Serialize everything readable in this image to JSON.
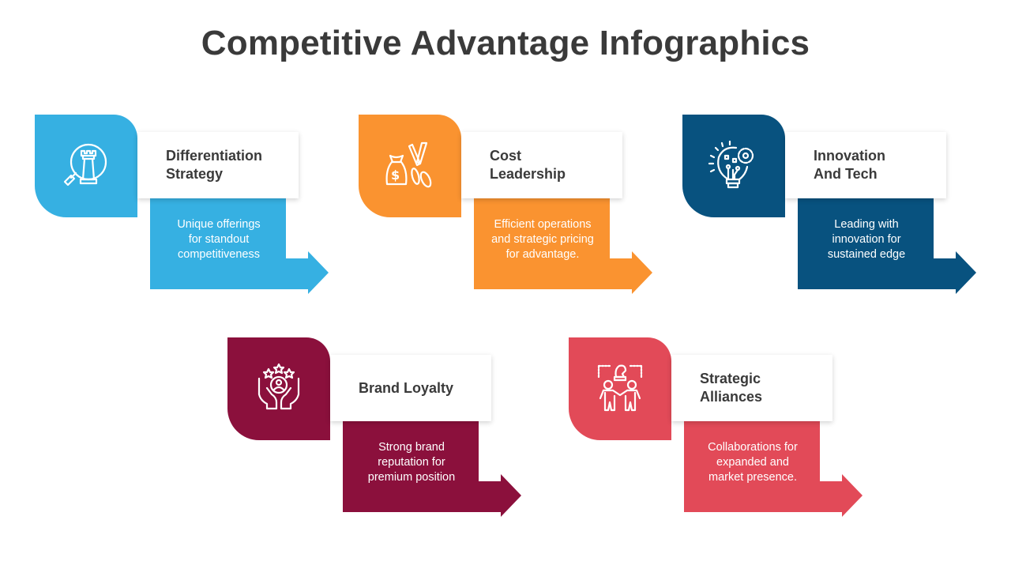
{
  "title": "Competitive Advantage Infographics",
  "cards": [
    {
      "id": "differentiation",
      "icon": "chess-rook-magnifier-icon",
      "title_line1": "Differentiation",
      "title_line2": "Strategy",
      "desc_line1": "Unique offerings",
      "desc_line2": "for standout",
      "desc_line3": "competitiveness",
      "color": "#36B0E2"
    },
    {
      "id": "cost-leadership",
      "icon": "money-bag-scissors-icon",
      "title_line1": "Cost",
      "title_line2": "Leadership",
      "desc_line1": "Efficient operations",
      "desc_line2": "and strategic pricing",
      "desc_line3": "for advantage.",
      "color": "#FA9330"
    },
    {
      "id": "innovation",
      "icon": "lightbulb-gear-icon",
      "title_line1": "Innovation",
      "title_line2": "And Tech",
      "desc_line1": "Leading with",
      "desc_line2": "innovation for",
      "desc_line3": "sustained edge",
      "color": "#08527F"
    },
    {
      "id": "brand-loyalty",
      "icon": "hands-user-stars-icon",
      "title_line1": "Brand Loyalty",
      "title_line2": "",
      "desc_line1": "Strong brand",
      "desc_line2": "reputation  for",
      "desc_line3": "premium position",
      "color": "#8B103C"
    },
    {
      "id": "strategic-alliances",
      "icon": "people-alliance-chess-icon",
      "title_line1": "Strategic",
      "title_line2": "Alliances",
      "desc_line1": "Collaborations for",
      "desc_line2": "expanded  and",
      "desc_line3": "market presence.",
      "color": "#E24A58"
    }
  ]
}
